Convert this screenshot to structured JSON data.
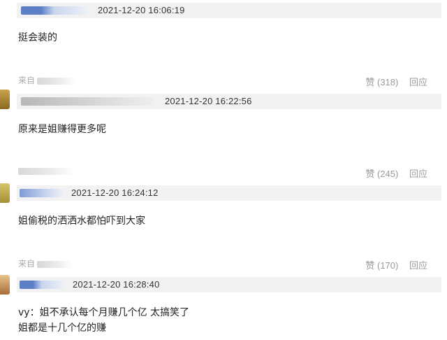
{
  "comments": [
    {
      "timestamp": "2021-12-20 16:06:19",
      "text_lines": [
        "挺会装的"
      ],
      "source_prefix": "来自",
      "like_label": "赞 (318)",
      "reply_label": "回应"
    },
    {
      "timestamp": "2021-12-20 16:22:56",
      "text_lines": [
        "原来是姐赚得更多呢"
      ],
      "source_prefix": "",
      "like_label": "赞 (245)",
      "reply_label": "回应"
    },
    {
      "timestamp": "2021-12-20 16:24:12",
      "text_lines": [
        "姐偷税的洒洒水都怕吓到大家"
      ],
      "source_prefix": "来自",
      "like_label": "赞 (170)",
      "reply_label": "回应"
    },
    {
      "timestamp": "2021-12-20 16:28:40",
      "text_lines": [
        "vy：姐不承认每个月赚几个亿 太搞笑了",
        "姐都是十几个亿的赚"
      ],
      "source_prefix": "",
      "like_label": "",
      "reply_label": ""
    }
  ],
  "colors": {
    "header_bg": "#f2f2f2",
    "action_text": "#999999",
    "source_text": "#aaaaaa"
  }
}
